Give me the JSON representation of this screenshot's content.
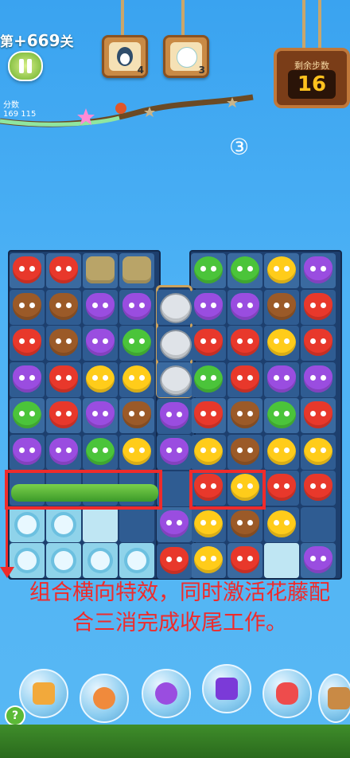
{
  "hud": {
    "level_prefix": "第",
    "level_number": "+669",
    "level_suffix": "关",
    "score_label": "分数",
    "score_value": "169 115",
    "moves_label": "剩余步数",
    "moves_value": "16",
    "targets": [
      {
        "icon": "penguin-icon",
        "count": "4"
      },
      {
        "icon": "polar-bear-icon",
        "count": "3"
      }
    ]
  },
  "annotation": {
    "step_marker": "③",
    "caption": "组合横向特效，同时激活花藤配合三消完成收尾工作。"
  },
  "boosters": [
    "shuffle-booster-icon",
    "clock-booster-icon",
    "swap-booster-icon",
    "row-clear-booster-icon",
    "hammer-booster-icon",
    "extra-booster-icon"
  ],
  "help_label": "?",
  "colors": {
    "highlight": "#ef2b2b",
    "board": "#1d3f6e"
  }
}
